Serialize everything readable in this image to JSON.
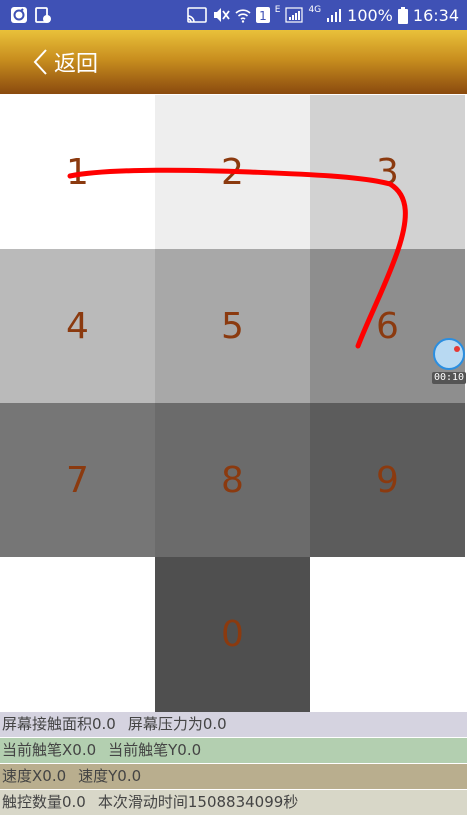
{
  "status_bar": {
    "network_label": "E",
    "net_4g": "4G",
    "battery": "100%",
    "time": "16:34",
    "sim_badge": "1",
    "background": "#3f51b5"
  },
  "header": {
    "back_label": "返回",
    "gradient_top": "#e9c13a",
    "gradient_bottom": "#8a4a0e"
  },
  "keypad": {
    "text_color": "#8b3a0f",
    "keys": [
      {
        "label": "1",
        "color": "#ffffff"
      },
      {
        "label": "2",
        "color": "#eeeeee"
      },
      {
        "label": "3",
        "color": "#d2d2d2"
      },
      {
        "label": "4",
        "color": "#bababa"
      },
      {
        "label": "5",
        "color": "#a8a8a8"
      },
      {
        "label": "6",
        "color": "#8e8e8e"
      },
      {
        "label": "7",
        "color": "#767676"
      },
      {
        "label": "8",
        "color": "#6b6b6b"
      },
      {
        "label": "9",
        "color": "#5c5c5c"
      },
      {
        "label": "0",
        "color": "#4f4f4f"
      }
    ],
    "trail_color": "#ff0000"
  },
  "timer": {
    "time": "00:10"
  },
  "info": {
    "row1": {
      "a": "屏幕接触面积0.0",
      "b": "屏幕压力为0.0",
      "color": "#d5d3e0"
    },
    "row2": {
      "a": "当前触笔X0.0",
      "b": "当前触笔Y0.0",
      "color": "#b3cfb0"
    },
    "row3": {
      "a": "速度X0.0",
      "b": "速度Y0.0",
      "color": "#b9ae8e"
    },
    "row4": {
      "a": "触控数量0.0",
      "b": "本次滑动时间1508834099秒",
      "color": "#d8d7c8"
    }
  }
}
